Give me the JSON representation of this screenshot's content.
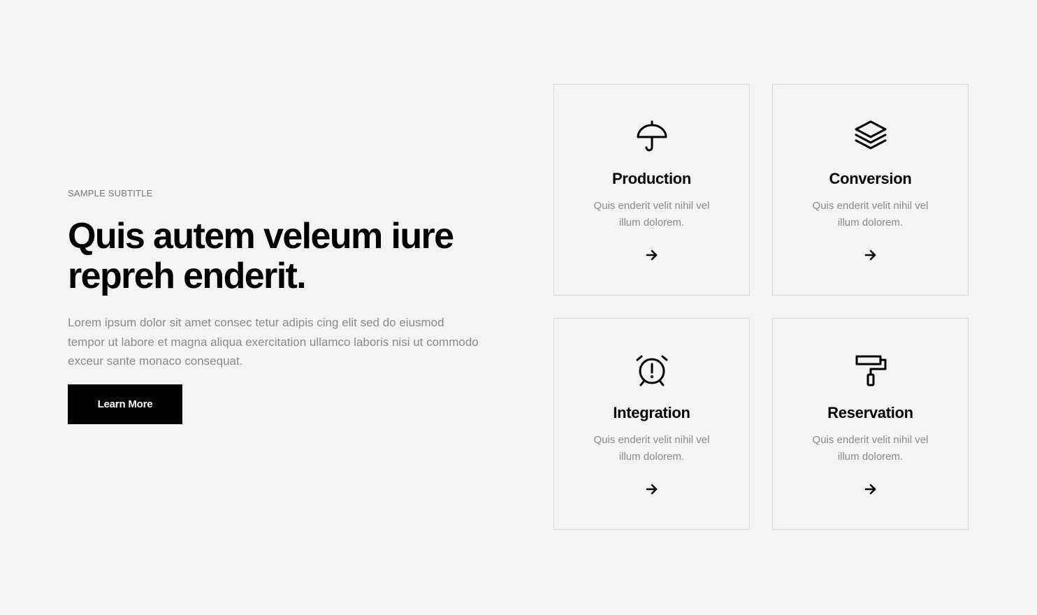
{
  "hero": {
    "subtitle": "SAMPLE SUBTITLE",
    "headline": "Quis autem veleum iure repreh enderit.",
    "description": "Lorem ipsum dolor sit amet consec tetur adipis cing elit sed do eiusmod tempor ut labore et magna aliqua exercitation ullamco laboris nisi ut commodo exceur sante monaco consequat.",
    "button_label": "Learn More"
  },
  "cards": [
    {
      "icon": "umbrella-icon",
      "title": "Production",
      "text": "Quis enderit velit nihil vel illum dolorem."
    },
    {
      "icon": "layers-icon",
      "title": "Conversion",
      "text": "Quis enderit velit nihil vel illum dolorem."
    },
    {
      "icon": "alarm-clock-icon",
      "title": "Integration",
      "text": "Quis enderit velit nihil vel illum dolorem."
    },
    {
      "icon": "paint-roller-icon",
      "title": "Reservation",
      "text": "Quis enderit velit nihil vel illum dolorem."
    }
  ],
  "colors": {
    "background": "#f4f4f4",
    "text": "#000000",
    "muted_text": "#8a8a8a",
    "border": "#d9d9d9",
    "button_background": "#000000",
    "button_text": "#ffffff"
  }
}
